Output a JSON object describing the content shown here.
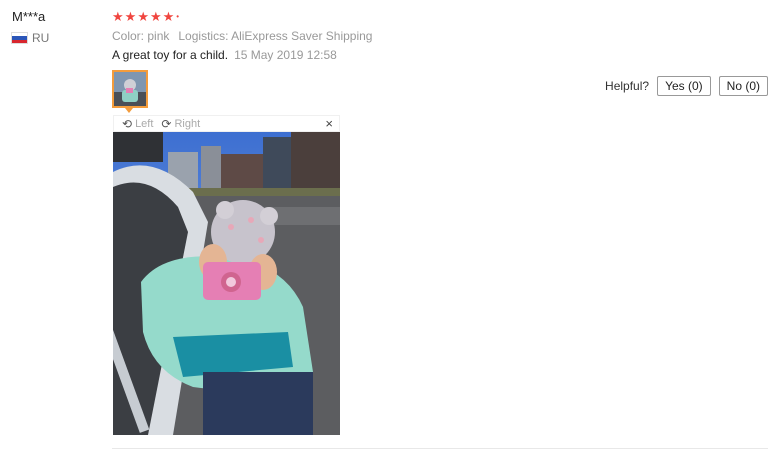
{
  "reviewer": {
    "name": "M***a",
    "country_code": "RU"
  },
  "rating": {
    "stars": 5
  },
  "review": {
    "color_label": "Color:",
    "color_value": "pink",
    "logistics_label": "Logistics:",
    "logistics_value": "AliExpress Saver Shipping",
    "text": "A great toy for a child.",
    "date": "15 May 2019 12:58"
  },
  "helpful": {
    "label": "Helpful?",
    "yes_label": "Yes (0)",
    "no_label": "No (0)"
  },
  "viewer": {
    "rotate_left_label": "Left",
    "rotate_right_label": "Right",
    "close_label": "×"
  },
  "colors": {
    "star": "#f0453f",
    "thumb_border": "#f39c3c"
  }
}
